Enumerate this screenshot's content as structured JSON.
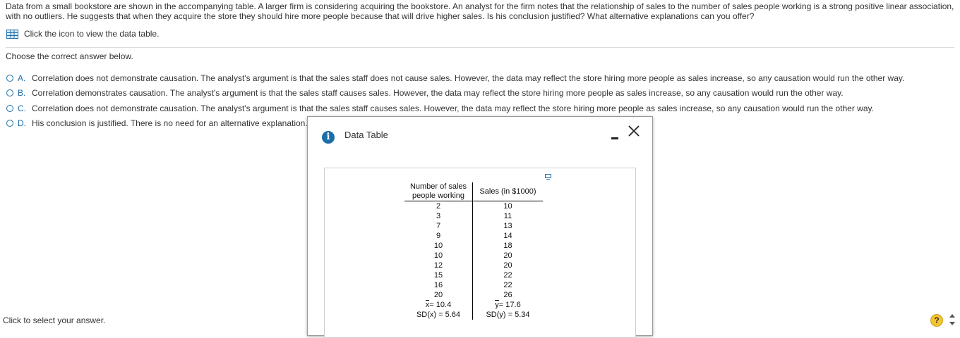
{
  "question": {
    "text": "Data from a small bookstore are shown in the accompanying table. A larger firm is considering acquiring the bookstore. An analyst for the firm notes that the relationship of sales to the number of sales people working is a strong positive linear association, with no outliers. He suggests that when they acquire the store they should hire more people because that will drive higher sales. Is his conclusion justified? What alternative explanations can you offer?",
    "data_link": "Click the icon to view the data table."
  },
  "instruction": "Choose the correct answer below.",
  "options": [
    {
      "letter": "A.",
      "text": "Correlation does not demonstrate causation. The analyst's argument is that the sales staff does not cause sales. However, the data may reflect the store hiring more people as sales increase, so any causation would run the other way."
    },
    {
      "letter": "B.",
      "text": "Correlation demonstrates causation. The analyst's argument is that the sales staff causes sales. However, the data may reflect the store hiring more people as sales increase, so any causation would run the other way."
    },
    {
      "letter": "C.",
      "text": "Correlation does not demonstrate causation. The analyst's argument is that the sales staff causes sales. However, the data may reflect the store hiring more people as sales increase, so any causation would run the other way."
    },
    {
      "letter": "D.",
      "text": "His conclusion is justified. There is no need for an alternative explanation."
    }
  ],
  "footer": {
    "text": "Click to select your answer.",
    "help": "?"
  },
  "dialog": {
    "info_glyph": "i",
    "title": "Data Table",
    "table": {
      "headers": [
        "Number of sales people working",
        "Sales (in $1000)"
      ],
      "rows": [
        [
          "2",
          "10"
        ],
        [
          "3",
          "11"
        ],
        [
          "7",
          "13"
        ],
        [
          "9",
          "14"
        ],
        [
          "10",
          "18"
        ],
        [
          "10",
          "20"
        ],
        [
          "12",
          "20"
        ],
        [
          "15",
          "22"
        ],
        [
          "16",
          "22"
        ],
        [
          "20",
          "26"
        ]
      ],
      "mean_x": {
        "symbol": "x",
        "value": "= 10.4"
      },
      "mean_y": {
        "symbol": "y",
        "value": "= 17.6"
      },
      "sd_x": "SD(x) = 5.64",
      "sd_y": "SD(y) = 5.34"
    }
  },
  "colors": {
    "accent": "#1b6ea8",
    "help": "#f4c430",
    "text": "#333333"
  }
}
